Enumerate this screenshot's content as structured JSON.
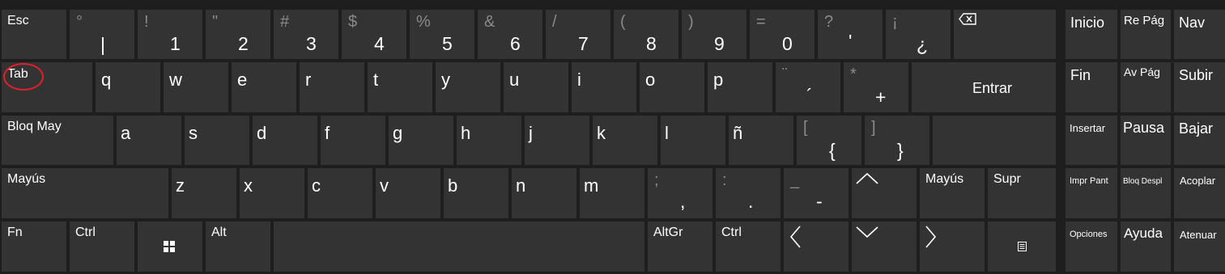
{
  "rows": {
    "numbers": [
      {
        "shift": "",
        "main": "Esc"
      },
      {
        "shift": "°",
        "main": "|"
      },
      {
        "shift": "!",
        "main": "1"
      },
      {
        "shift": "\"",
        "main": "2"
      },
      {
        "shift": "#",
        "main": "3"
      },
      {
        "shift": "$",
        "main": "4"
      },
      {
        "shift": "%",
        "main": "5"
      },
      {
        "shift": "&",
        "main": "6"
      },
      {
        "shift": "/",
        "main": "7"
      },
      {
        "shift": "(",
        "main": "8"
      },
      {
        "shift": ")",
        "main": "9"
      },
      {
        "shift": "=",
        "main": "0"
      },
      {
        "shift": "?",
        "main": "'"
      },
      {
        "shift": "¡",
        "main": "¿"
      }
    ],
    "qwerty": [
      {
        "main": "Tab"
      },
      {
        "main": "q"
      },
      {
        "main": "w"
      },
      {
        "main": "e"
      },
      {
        "main": "r"
      },
      {
        "main": "t"
      },
      {
        "main": "y"
      },
      {
        "main": "u"
      },
      {
        "main": "i"
      },
      {
        "main": "o"
      },
      {
        "main": "p"
      },
      {
        "shift": "¨",
        "main": "´"
      },
      {
        "shift": "*",
        "main": "+"
      },
      {
        "main": "Entrar"
      }
    ],
    "home": [
      {
        "main": "Bloq May"
      },
      {
        "main": "a"
      },
      {
        "main": "s"
      },
      {
        "main": "d"
      },
      {
        "main": "f"
      },
      {
        "main": "g"
      },
      {
        "main": "h"
      },
      {
        "main": "j"
      },
      {
        "main": "k"
      },
      {
        "main": "l"
      },
      {
        "main": "ñ"
      },
      {
        "shift": "[",
        "main": "{"
      },
      {
        "shift": "]",
        "main": "}"
      }
    ],
    "bottom": [
      {
        "main": "Mayús"
      },
      {
        "main": "z"
      },
      {
        "main": "x"
      },
      {
        "main": "c"
      },
      {
        "main": "v"
      },
      {
        "main": "b"
      },
      {
        "main": "n"
      },
      {
        "main": "m"
      },
      {
        "shift": ";",
        "main": ","
      },
      {
        "shift": ":",
        "main": "."
      },
      {
        "shift": "_",
        "main": "-"
      },
      {
        "main": "Mayús"
      },
      {
        "main": "Supr"
      }
    ],
    "space": [
      {
        "main": "Fn"
      },
      {
        "main": "Ctrl"
      },
      {
        "main": "Alt"
      },
      {
        "main": "AltGr"
      },
      {
        "main": "Ctrl"
      }
    ]
  },
  "side": [
    [
      "Inicio",
      "Re Pág",
      "Nav"
    ],
    [
      "Fin",
      "Av Pág",
      "Subir"
    ],
    [
      "Insertar",
      "Pausa",
      "Bajar"
    ],
    [
      "Impr Pant",
      "Bloq Despl",
      "Acoplar"
    ],
    [
      "Opciones",
      "Ayuda",
      "Atenuar"
    ]
  ],
  "icons": {
    "backspace": "backspace-icon",
    "windows": "windows-icon",
    "up": "arrow-up-icon",
    "down": "arrow-down-icon",
    "left": "arrow-left-icon",
    "right": "arrow-right-icon",
    "menu": "menu-key-icon"
  },
  "colors": {
    "background": "#1e1e1e",
    "key": "#333333",
    "text": "#ffffff",
    "secondary_text": "#8a8a8a",
    "highlight_ring": "#e0202a"
  }
}
